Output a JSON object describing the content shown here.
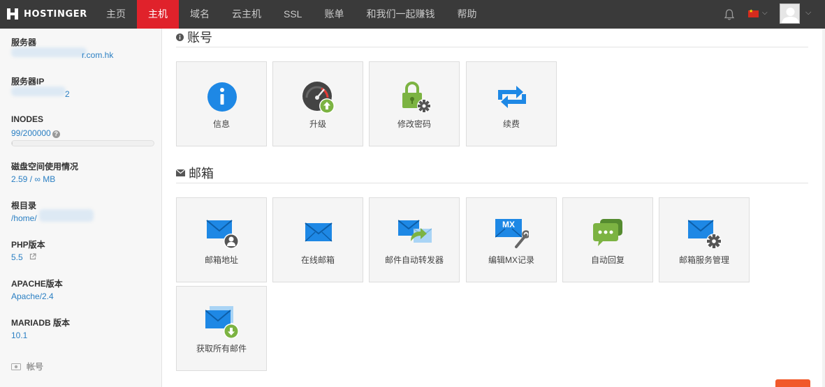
{
  "brand": {
    "name": "HOSTINGER"
  },
  "nav": {
    "items": [
      {
        "label": "主页"
      },
      {
        "label": "主机",
        "active": true
      },
      {
        "label": "域名"
      },
      {
        "label": "云主机"
      },
      {
        "label": "SSL"
      },
      {
        "label": "账单"
      },
      {
        "label": "和我们一起赚钱"
      },
      {
        "label": "帮助"
      }
    ],
    "icons": {
      "notifications": "bell-icon",
      "language": "china-flag-icon",
      "user": "avatar-icon"
    }
  },
  "sidebar": {
    "server_label": "服务器",
    "server_value": "r.com.hk",
    "server_ip_label": "服务器IP",
    "server_ip_value": "2",
    "inodes_label": "INODES",
    "inodes_value": "99/200000",
    "inodes_usage_fraction": 0.0005,
    "disk_label": "磁盘空间使用情况",
    "disk_value": "2.59 / ∞ MB",
    "root_label": "根目录",
    "root_value": "/home/",
    "php_label": "PHP版本",
    "php_value": "5.5",
    "apache_label": "APACHE版本",
    "apache_value": "Apache/2.4",
    "mariadb_label": "MARIADB 版本",
    "mariadb_value": "10.1",
    "section_account": "帐号"
  },
  "account": {
    "title": "账号",
    "tiles": [
      {
        "label": "信息",
        "icon": "info-icon"
      },
      {
        "label": "升级",
        "icon": "speedometer-upgrade-icon"
      },
      {
        "label": "修改密码",
        "icon": "lock-gear-icon"
      },
      {
        "label": "续费",
        "icon": "renew-arrows-icon"
      }
    ]
  },
  "email": {
    "title": "邮箱",
    "tiles": [
      {
        "label": "邮箱地址",
        "icon": "mail-user-icon"
      },
      {
        "label": "在线邮箱",
        "icon": "webmail-icon"
      },
      {
        "label": "邮件自动转发器",
        "icon": "mail-forward-icon"
      },
      {
        "label": "编辑MX记录",
        "icon": "mx-record-icon"
      },
      {
        "label": "自动回复",
        "icon": "autoreply-chat-icon"
      },
      {
        "label": "邮箱服务管理",
        "icon": "mail-settings-icon"
      },
      {
        "label": "获取所有邮件",
        "icon": "mail-download-icon"
      }
    ]
  },
  "colors": {
    "nav_bg": "#3a3a3a",
    "nav_active": "#e0222b",
    "link": "#2a7fc3",
    "icon_blue": "#1e88e5",
    "icon_green": "#7cb342"
  }
}
